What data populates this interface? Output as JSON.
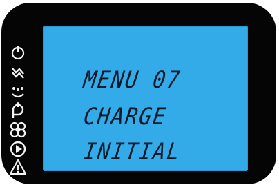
{
  "display": {
    "lines": [
      "MENU 07",
      "CHARGE",
      "INITIAL"
    ]
  },
  "icons": [
    "power-icon",
    "lightning-icon",
    "fan-icon",
    "timer-icon",
    "play-icon",
    "warning-icon"
  ],
  "colors": {
    "bezel": "#050505",
    "screen": "#33abe8",
    "segment_text": "#0b1a2a",
    "icon": "#f2f2f2"
  }
}
